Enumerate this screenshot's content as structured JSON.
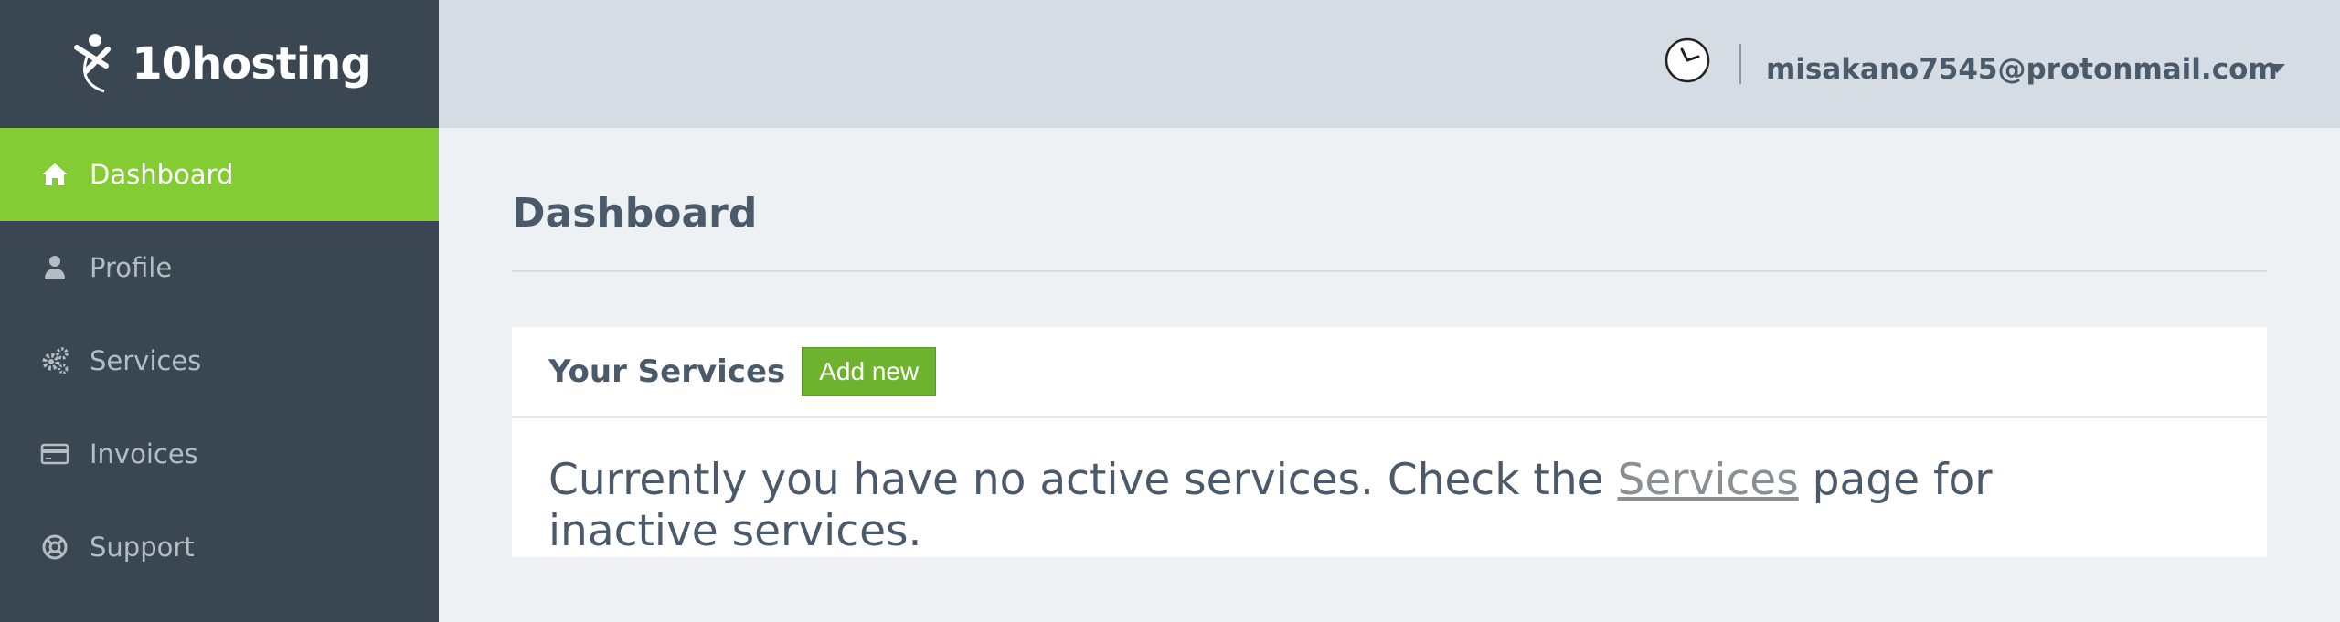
{
  "brand": {
    "logo_text": "10hosting"
  },
  "sidebar": {
    "items": [
      {
        "label": "Dashboard",
        "icon": "home-icon",
        "active": true
      },
      {
        "label": "Profile",
        "icon": "user-icon",
        "active": false
      },
      {
        "label": "Services",
        "icon": "gears-icon",
        "active": false
      },
      {
        "label": "Invoices",
        "icon": "credit-card-icon",
        "active": false
      },
      {
        "label": "Support",
        "icon": "lifebuoy-icon",
        "active": false
      }
    ]
  },
  "header": {
    "user_email": "misakano7545@protonmail.com",
    "clock_icon": "clock-icon",
    "menu_icon": "chevron-down-icon"
  },
  "main": {
    "page_title": "Dashboard",
    "services_panel": {
      "title": "Your Services",
      "add_button": "Add new",
      "message_prefix": "Currently you have no active services. Check the ",
      "message_link": "Services",
      "message_suffix": " page for inactive services."
    }
  },
  "colors": {
    "sidebar_bg": "#3a4651",
    "active_nav": "#83cc34",
    "header_bg": "#d5dce4",
    "page_bg": "#edf1f4",
    "button_bg": "#6db32d"
  }
}
